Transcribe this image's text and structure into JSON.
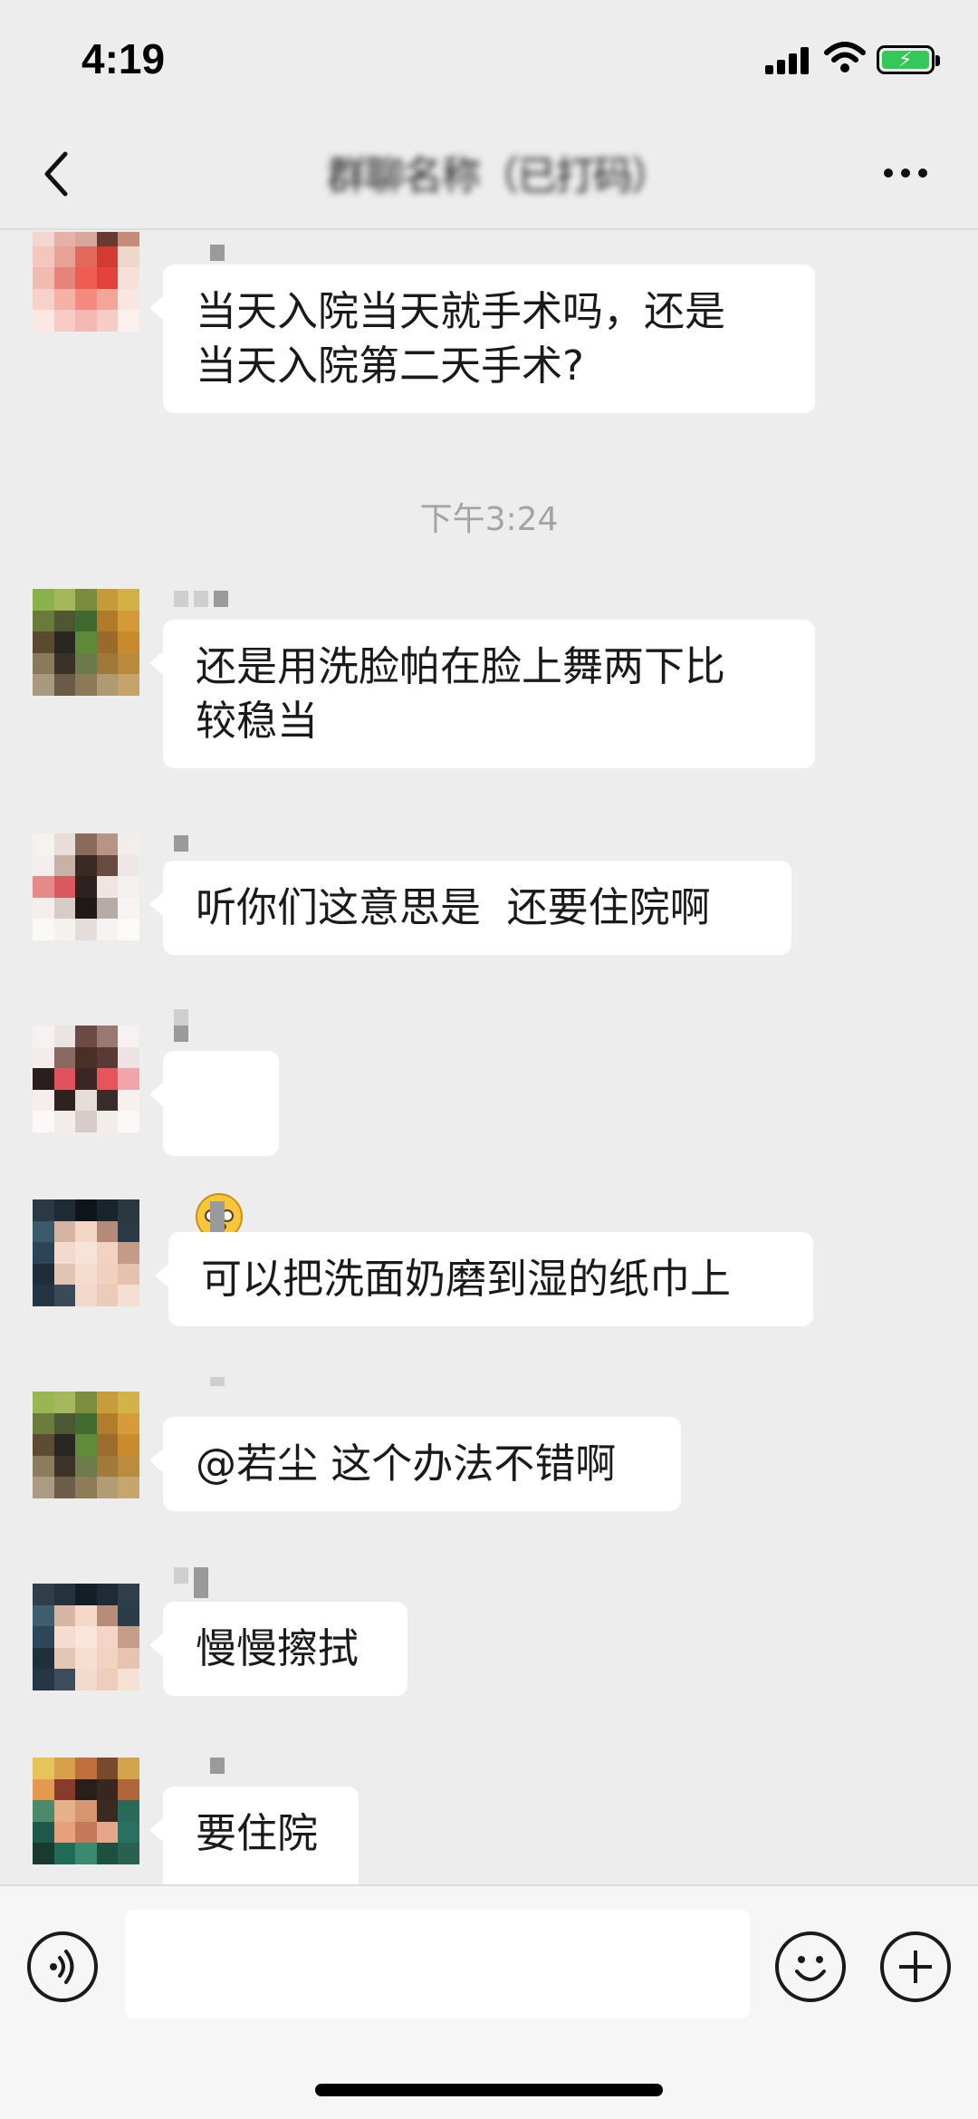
{
  "status_bar": {
    "time": "4:19"
  },
  "header": {
    "title": "群聊名称（已打码）"
  },
  "messages": [
    {
      "text": "当天入院当天就手术吗，还是\n当天入院第二天手术?"
    },
    {
      "text": "还是用洗脸帕在脸上舞两下比\n较稳当"
    },
    {
      "text": "听你们这意思是  还要住院啊"
    },
    {
      "emoji": "astonished-face-emoji"
    },
    {
      "text": "可以把洗面奶磨到湿的纸巾上"
    },
    {
      "text": "@若尘 这个办法不错啊"
    },
    {
      "text": "慢慢擦拭"
    },
    {
      "text": "要住院"
    }
  ],
  "timestamp": "下午3:24",
  "input_bar": {
    "value": ""
  },
  "colors": {
    "background": "#ededed",
    "bubble": "#ffffff",
    "battery": "#34c759"
  }
}
